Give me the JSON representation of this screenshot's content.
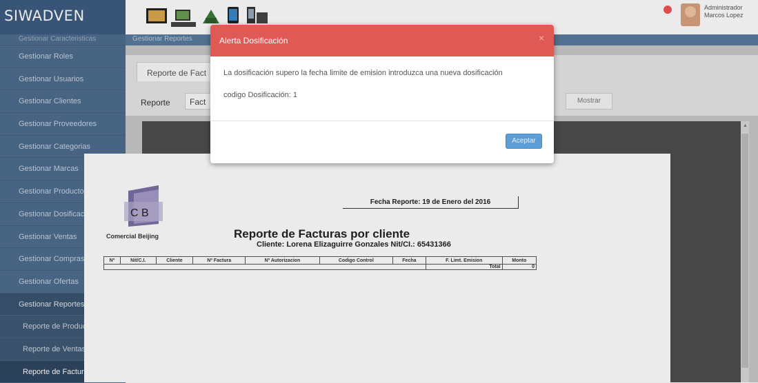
{
  "app": {
    "brand": "SIWADVEN"
  },
  "header": {
    "icons": [
      "monitor-icon",
      "laptop-icon",
      "chart-icon",
      "tablet-icon",
      "phone-icon"
    ],
    "user_name_line1": "Administrador",
    "user_name_line2": "Marcos Lopez"
  },
  "sidebar": {
    "items": [
      {
        "label": "Gestionar Caracteristicas"
      },
      {
        "label": "Gestionar Roles"
      },
      {
        "label": "Gestionar Usuarios"
      },
      {
        "label": "Gestionar Clientes"
      },
      {
        "label": "Gestionar Proveedores"
      },
      {
        "label": "Gestionar Categorias"
      },
      {
        "label": "Gestionar Marcas"
      },
      {
        "label": "Gestionar Productos"
      },
      {
        "label": "Gestionar Dosificaciones"
      },
      {
        "label": "Gestionar Ventas"
      },
      {
        "label": "Gestionar Compras"
      },
      {
        "label": "Gestionar Ofertas"
      },
      {
        "label": "Gestionar Reportes"
      },
      {
        "label": "Reporte de Productos"
      },
      {
        "label": "Reporte de Ventas"
      },
      {
        "label": "Reporte de Facturas"
      }
    ]
  },
  "breadcrumb": {
    "text": "Gestionar Reportes"
  },
  "main": {
    "tab_label": "Reporte de Fact",
    "reporte_label": "Reporte",
    "select_value": "Fact",
    "mostrar_label": "Mostrar"
  },
  "report": {
    "logo_letters": "C B",
    "logo_caption": "Comercial Beijing",
    "fecha": "Fecha Reporte: 19 de Enero del 2016",
    "title": "Reporte de Facturas por cliente",
    "subtitle": "Cliente: Lorena Elizaguirre Gonzales Nit/CI.: 65431366",
    "columns": [
      "Nº",
      "Nit/C.I.",
      "Cliente",
      "Nº Factura",
      "Nº Autorizacion",
      "Codigo Control",
      "Fecha",
      "F. Limt. Emision",
      "Monto"
    ],
    "total_label": "Total",
    "total_value": "0"
  },
  "modal": {
    "title": "Alerta Dosificación",
    "close": "×",
    "message": "La dosificación supero la fecha limite de emision introduzca una nueva dosificación",
    "code_line": "codigo Dosificación: 1",
    "ok_label": "Aceptar"
  }
}
